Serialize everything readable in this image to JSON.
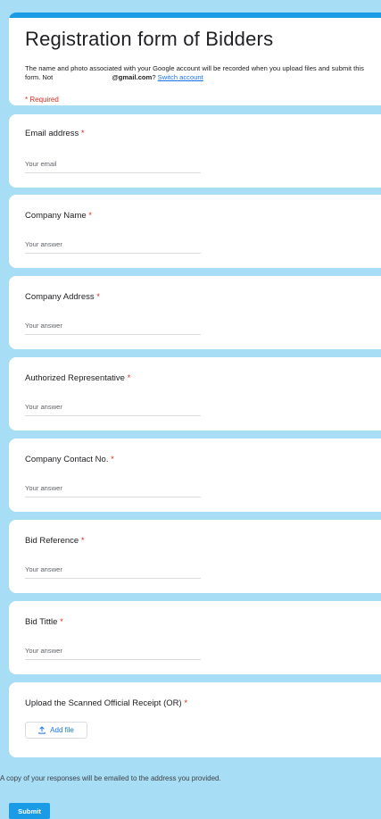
{
  "form": {
    "title": "Registration form of Bidders",
    "description_before": "The name and photo associated with your Google account will be recorded when you upload files and submit this form. Not ",
    "email": "@gmail.com",
    "question_mark": "?",
    "switch_account": "Switch account",
    "required_note": "* Required"
  },
  "questions": [
    {
      "label": "Email address",
      "placeholder": "Your email"
    },
    {
      "label": "Company Name",
      "placeholder": "Your answer"
    },
    {
      "label": "Company Address",
      "placeholder": "Your answer"
    },
    {
      "label": "Authorized Representative",
      "placeholder": "Your answer"
    },
    {
      "label": "Company Contact No.",
      "placeholder": "Your answer"
    },
    {
      "label": "Bid Reference",
      "placeholder": "Your answer"
    },
    {
      "label": "Bid Tittle",
      "placeholder": "Your answer"
    }
  ],
  "upload": {
    "label": "Upload the Scanned Official Receipt (OR)",
    "button_label": "Add file",
    "icon": "upload-icon"
  },
  "required_star": "*",
  "footer": {
    "note": "A copy of your responses will be emailed to the address you provided.",
    "submit_label": "Submit"
  },
  "colors": {
    "accent": "#1a9be6",
    "background": "#a8ddf6",
    "required": "#d93025",
    "link": "#1a73e8"
  }
}
